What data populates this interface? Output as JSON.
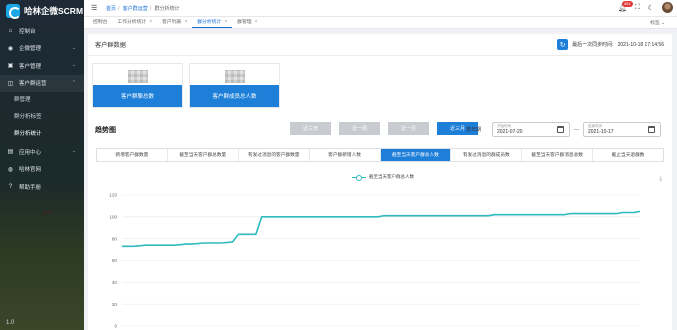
{
  "app": {
    "title": "哈林企微SCRM"
  },
  "sidebar": {
    "items": [
      {
        "label": "控制台",
        "icon": "home-icon",
        "has_children": false
      },
      {
        "label": "企微管理",
        "icon": "wechat-icon",
        "has_children": true
      },
      {
        "label": "客户管理",
        "icon": "users-icon",
        "has_children": true
      },
      {
        "label": "客户群运营",
        "icon": "group-icon",
        "has_children": true,
        "open": true
      },
      {
        "label": "应用中心",
        "icon": "apps-icon",
        "has_children": true
      },
      {
        "label": "哈林官网",
        "icon": "globe-icon",
        "has_children": false
      },
      {
        "label": "帮助手册",
        "icon": "help-icon",
        "has_children": false
      }
    ],
    "sub_items": [
      {
        "label": "群管理"
      },
      {
        "label": "群分析标签"
      },
      {
        "label": "群分析统计",
        "active": true
      }
    ],
    "footer": "1.0"
  },
  "header": {
    "breadcrumbs": [
      "首页",
      "客户群运营",
      "群分析统计"
    ],
    "notification_count": "451"
  },
  "tabs": {
    "items": [
      {
        "label": "控制台",
        "closable": false
      },
      {
        "label": "工作分析统计",
        "closable": true
      },
      {
        "label": "客户列表",
        "closable": true
      },
      {
        "label": "群分析统计",
        "closable": true,
        "active": true
      },
      {
        "label": "群管理",
        "closable": true
      }
    ],
    "right_label": "标签"
  },
  "section": {
    "title": "客户群数据",
    "sync_label": "最后一次同步时间:",
    "sync_time": "2021-10-18 17:14:56"
  },
  "cards": [
    {
      "label": "客户群聊总数"
    },
    {
      "label": "客户群成员总人数"
    }
  ],
  "trend": {
    "title": "趋势图",
    "ranges": [
      "近三天",
      "近一周",
      "近一月",
      "近三月"
    ],
    "active_range": 3,
    "period_label": "按日期",
    "start_label": "开始时间",
    "start_date": "2021-07-20",
    "end_label": "结束时间",
    "end_date": "2021-10-17"
  },
  "metric_tabs": [
    "新增客户群数量",
    "截至当天客户群总数量",
    "有发过消息的客户群数量",
    "客户群新增人数",
    "截至当天客户群总人数",
    "有发过消息的群成员数",
    "截至当天客户群消息总数",
    "截止当天退群数"
  ],
  "active_metric": 4,
  "chart_data": {
    "type": "line",
    "legend": "截至当天客户群总人数",
    "color": "#2dbbc0",
    "y_ticks": [
      0,
      20,
      40,
      60,
      80,
      100,
      120
    ],
    "ylim": [
      0,
      120
    ],
    "grid": true,
    "values": [
      73,
      73,
      73,
      73.5,
      74,
      74,
      74,
      74,
      74,
      74,
      74.5,
      75,
      75,
      75.5,
      76,
      76,
      76,
      76,
      76.5,
      77,
      84,
      84,
      84,
      84,
      100,
      100,
      100,
      100,
      100,
      100,
      100,
      100,
      100,
      100,
      100,
      100,
      100,
      100,
      100,
      100,
      100,
      100,
      100,
      100,
      100,
      101,
      101,
      101,
      101,
      101,
      101,
      101,
      101,
      101,
      101,
      101,
      101,
      101,
      101,
      101,
      101,
      101,
      101,
      101,
      102,
      102,
      102,
      102,
      102,
      102,
      102,
      102,
      102,
      102,
      102,
      102,
      102,
      103,
      103,
      103,
      103,
      103,
      103,
      103,
      103,
      103,
      104,
      104,
      104,
      105
    ]
  }
}
